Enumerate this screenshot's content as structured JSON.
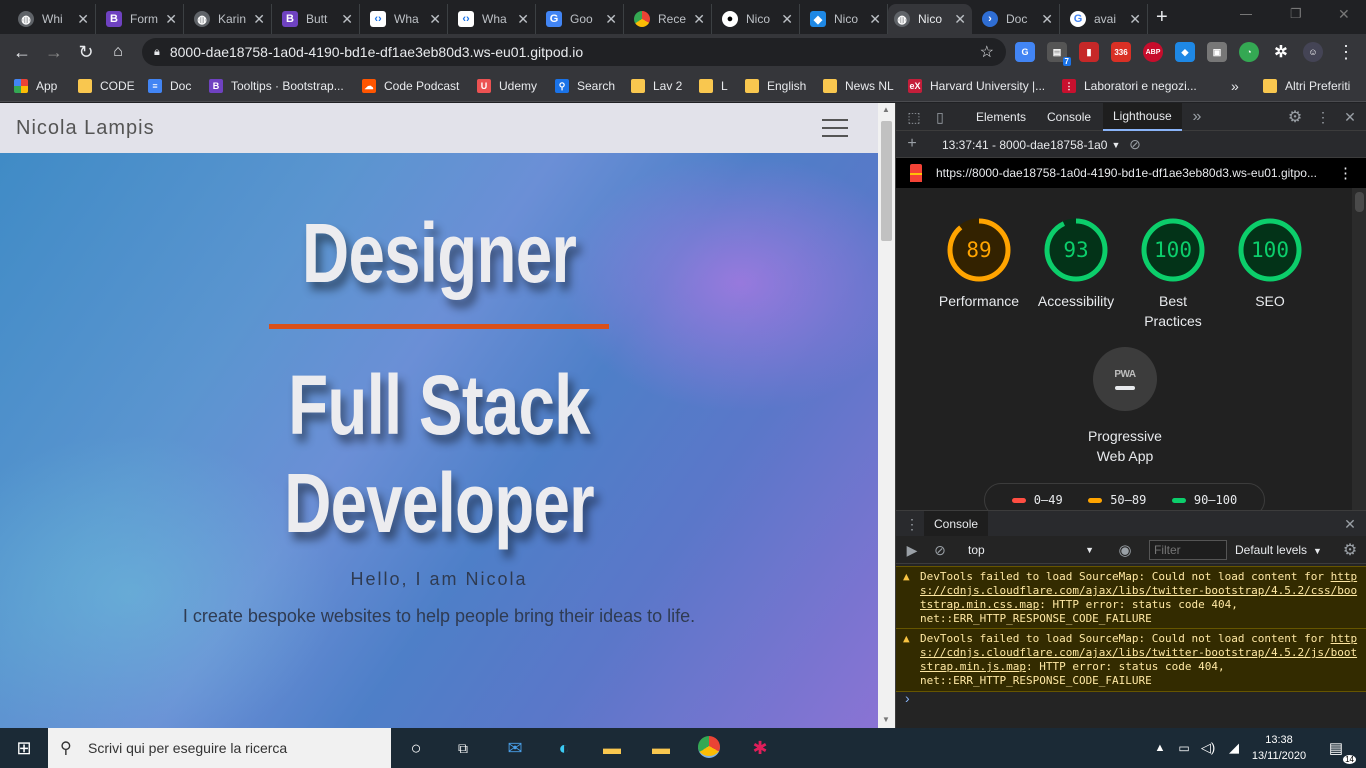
{
  "tabs": [
    {
      "label": "Whi",
      "icon": "globe-icon",
      "color": "#5f6368"
    },
    {
      "label": "Form",
      "icon": "bootstrap-icon",
      "color": "#6f42c1"
    },
    {
      "label": "Karin",
      "icon": "globe-icon",
      "color": "#5f6368"
    },
    {
      "label": "Butt",
      "icon": "bootstrap-icon",
      "color": "#6f42c1"
    },
    {
      "label": "Wha",
      "icon": "code-icon",
      "color": "#ffffff"
    },
    {
      "label": "Wha",
      "icon": "code-icon",
      "color": "#ffffff"
    },
    {
      "label": "Goo",
      "icon": "google-translate-icon",
      "color": "#4285f4"
    },
    {
      "label": "Rece",
      "icon": "chrome-ring-icon",
      "color": "#ea4335"
    },
    {
      "label": "Nico",
      "icon": "github-icon",
      "color": "#ffffff"
    },
    {
      "label": "Nico",
      "icon": "gitpod-icon",
      "color": "#1e88e5"
    },
    {
      "label": "Nico",
      "icon": "globe-icon",
      "color": "#5f6368",
      "active": true
    },
    {
      "label": "Doc",
      "icon": "powershell-icon",
      "color": "#2f6ed4"
    },
    {
      "label": "avai",
      "icon": "google-icon",
      "color": "#ffffff"
    }
  ],
  "window": {
    "restore": "❐",
    "close": "✕",
    "new_tab": "+"
  },
  "toolbar": {
    "url": "8000-dae18758-1a0d-4190-bd1e-df1ae3eb80d3.ws-eu01.gitpod.io",
    "badge_7": "7",
    "badge_336": "336",
    "badge_abp": "ABP"
  },
  "bookmarks": [
    {
      "label": "App",
      "icon": "apps-grid-icon",
      "color": "#ea4335"
    },
    {
      "label": "CODE",
      "icon": "folder-icon",
      "color": "#f9c74f"
    },
    {
      "label": "Doc",
      "icon": "google-docs-icon",
      "color": "#4285f4"
    },
    {
      "label": "Tooltips · Bootstrap...",
      "icon": "bootstrap-icon",
      "color": "#6f42c1"
    },
    {
      "label": "Code Podcast",
      "icon": "soundcloud-icon",
      "color": "#ff5500"
    },
    {
      "label": "Udemy",
      "icon": "udemy-icon",
      "color": "#ec5252"
    },
    {
      "label": "Search",
      "icon": "search-shield-icon",
      "color": "#1a73e8"
    },
    {
      "label": "Lav 2",
      "icon": "folder-icon",
      "color": "#f9c74f"
    },
    {
      "label": "L",
      "icon": "folder-icon",
      "color": "#f9c74f"
    },
    {
      "label": "English",
      "icon": "folder-icon",
      "color": "#f9c74f"
    },
    {
      "label": "News NL",
      "icon": "folder-icon",
      "color": "#f9c74f"
    },
    {
      "label": "Harvard University |...",
      "icon": "edx-icon",
      "color": "#c41e3a"
    },
    {
      "label": "Laboratori e negozi...",
      "icon": "laboratori-icon",
      "color": "#c8102e"
    }
  ],
  "bookmarks_more": "»",
  "bookmarks_other": "Altri Preferiti",
  "site": {
    "brand": "Nicola Lampis",
    "hero_line1": "Designer",
    "hero_line2": "Full Stack",
    "hero_line3": "Developer",
    "hello": "Hello, I am Nicola",
    "tagline": "I create bespoke websites to help people bring their ideas to life.",
    "accent": "#d9501a"
  },
  "devtools": {
    "tabs": [
      "Elements",
      "Console",
      "Lighthouse"
    ],
    "active_tab": "Lighthouse",
    "more": "»",
    "report_selector": "13:37:41 - 8000-dae18758-1a0",
    "report_url": "https://8000-dae18758-1a0d-4190-bd1e-df1ae3eb80d3.ws-eu01.gitpo...",
    "scores": [
      {
        "label": "Performance",
        "value": "89",
        "score": 0.89,
        "color": "#ffa400",
        "track": "#332200"
      },
      {
        "label": "Accessibility",
        "value": "93",
        "score": 0.93,
        "color": "#0cce6b",
        "track": "#033318"
      },
      {
        "label": "Best Practices",
        "value": "100",
        "score": 1.0,
        "color": "#0cce6b",
        "track": "#033318"
      },
      {
        "label": "SEO",
        "value": "100",
        "score": 1.0,
        "color": "#0cce6b",
        "track": "#033318"
      }
    ],
    "pwa_badge": "PWA",
    "pwa_label": "Progressive Web App",
    "legend": [
      {
        "label": "0–49",
        "color": "#ff4e42"
      },
      {
        "label": "50–89",
        "color": "#ffa400"
      },
      {
        "label": "90–100",
        "color": "#0cce6b"
      }
    ],
    "console": {
      "title": "Console",
      "context": "top",
      "filter_placeholder": "Filter",
      "levels": "Default levels",
      "warnings": [
        {
          "prefix": "DevTools failed to load SourceMap: Could not load content for ",
          "link": "https://cdnjs.cloudflare.com/ajax/libs/twitter-bootstrap/4.5.2/css/bootstrap.min.css.map",
          "suffix": ": HTTP error: status code 404, net::ERR_HTTP_RESPONSE_CODE_FAILURE"
        },
        {
          "prefix": "DevTools failed to load SourceMap: Could not load content for ",
          "link": "https://cdnjs.cloudflare.com/ajax/libs/twitter-bootstrap/4.5.2/js/bootstrap.min.js.map",
          "suffix": ": HTTP error: status code 404, net::ERR_HTTP_RESPONSE_CODE_FAILURE"
        }
      ],
      "prompt": "›"
    }
  },
  "taskbar": {
    "search_placeholder": "Scrivi qui per eseguire la ricerca",
    "time": "13:38",
    "date": "13/11/2020",
    "notifications": "14"
  }
}
